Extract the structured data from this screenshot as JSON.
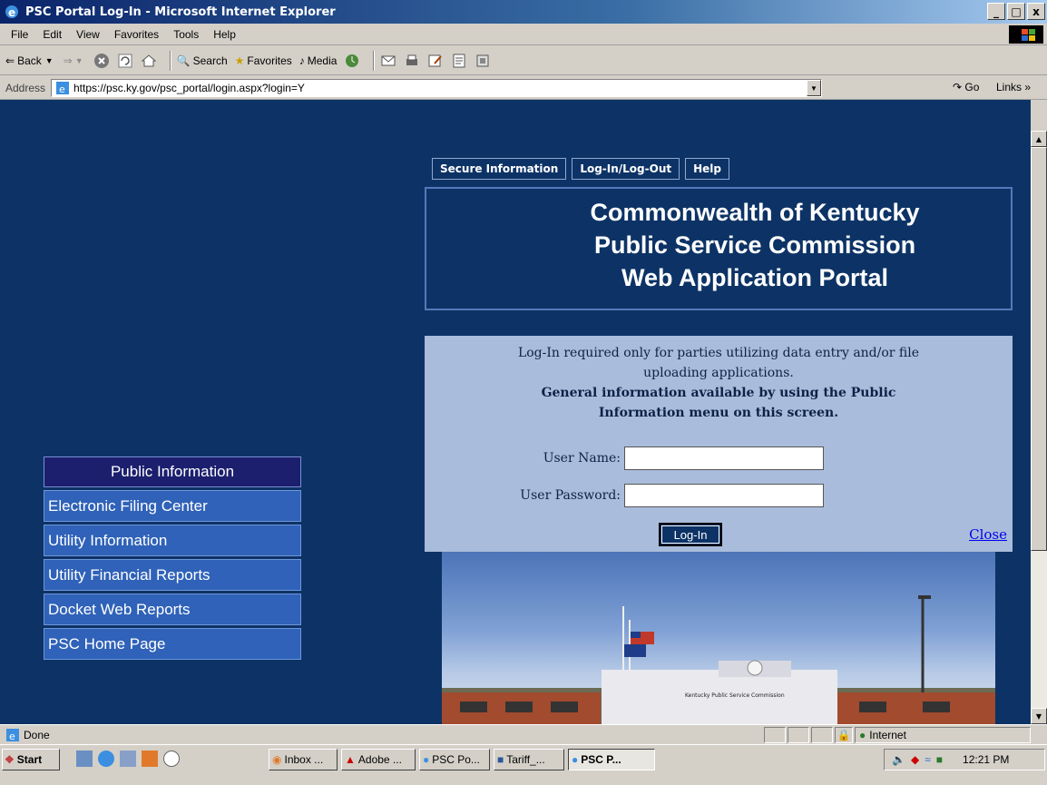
{
  "window": {
    "title": "PSC Portal Log-In - Microsoft Internet Explorer",
    "controls": [
      "_",
      "□",
      "x"
    ]
  },
  "menu": {
    "items": [
      "File",
      "Edit",
      "View",
      "Favorites",
      "Tools",
      "Help"
    ]
  },
  "toolbar": {
    "back_label": "Back",
    "search_label": "Search",
    "favorites_label": "Favorites",
    "media_label": "Media"
  },
  "addressbar": {
    "label": "Address",
    "url": "https://psc.ky.gov/psc_portal/login.aspx?login=Y",
    "go_label": "Go",
    "links_label": "Links"
  },
  "page": {
    "topnav": [
      "Secure Information",
      "Log-In/Log-Out",
      "Help"
    ],
    "header_lines": [
      "Commonwealth of Kentucky",
      "Public Service Commission",
      "Web Application Portal"
    ],
    "login": {
      "note_line1": "Log-In required only for parties utilizing data entry and/or file",
      "note_line2": "uploading applications.",
      "bold_line1": "General information available by using the Public",
      "bold_line2": "Information menu on this screen.",
      "username_label": "User Name:",
      "username_value": "",
      "password_label": "User Password:",
      "password_value": "",
      "submit_label": "Log-In",
      "close_label": "Close"
    },
    "leftnav": {
      "header": "Public Information",
      "items": [
        "Electronic Filing Center",
        "Utility Information",
        "Utility Financial Reports",
        "Docket Web Reports",
        "PSC Home Page"
      ]
    },
    "photo_sign": "Kentucky Public Service Commission"
  },
  "status": {
    "text": "Done",
    "zone": "Internet"
  },
  "taskbar": {
    "start_label": "Start",
    "tasks": [
      "Inbox ...",
      "Adobe ...",
      "PSC Po...",
      "Tariff_...",
      "PSC P..."
    ],
    "clock": "12:21 PM"
  }
}
